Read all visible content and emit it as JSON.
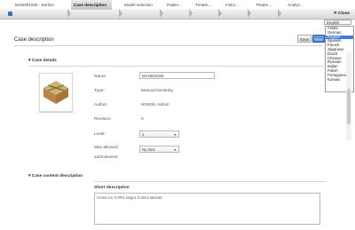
{
  "topbar": {
    "app_label": "MAN001026 - Karline",
    "crumbs": [
      "Case description",
      "Model selection",
      "Patien...",
      "Treatm...",
      "Instru...",
      "Treatm...",
      "Analys..."
    ],
    "close_label": "Close"
  },
  "language": {
    "selected": "English",
    "options": [
      "Arabic",
      "German",
      "English",
      "Spanish",
      "French",
      "Japanese",
      "Dutch",
      "Chinese",
      "Russian",
      "Italian",
      "Polish",
      "Portuguese",
      "Korean"
    ]
  },
  "header": {
    "title": "Case description",
    "save_label": "Save",
    "blue_label": "Next"
  },
  "case_details": {
    "section_title": "Case details",
    "name_label": "Name:",
    "name_value": "MAN001026",
    "type_label": "Type:",
    "type_value": "Manual Dexterity",
    "author_label": "Author:",
    "author_value": "NOMSL Admin",
    "revision_label": "Revision:",
    "revision_value": "5",
    "level_label": "Level:",
    "level_value": "2",
    "max_label_1": "Max allowed",
    "max_label_2": "submissions:",
    "max_value": "No limit"
  },
  "case_content": {
    "section_title": "Case content description",
    "short_desc_label": "Short description",
    "short_desc_value": "Cross cut, 0.00% target, 0.2mm laterals"
  },
  "colors": {
    "accent": "#3b7de0",
    "tile_top": "#c99a62",
    "cross": "#3a9a3a",
    "cross_red": "#c0392b"
  }
}
